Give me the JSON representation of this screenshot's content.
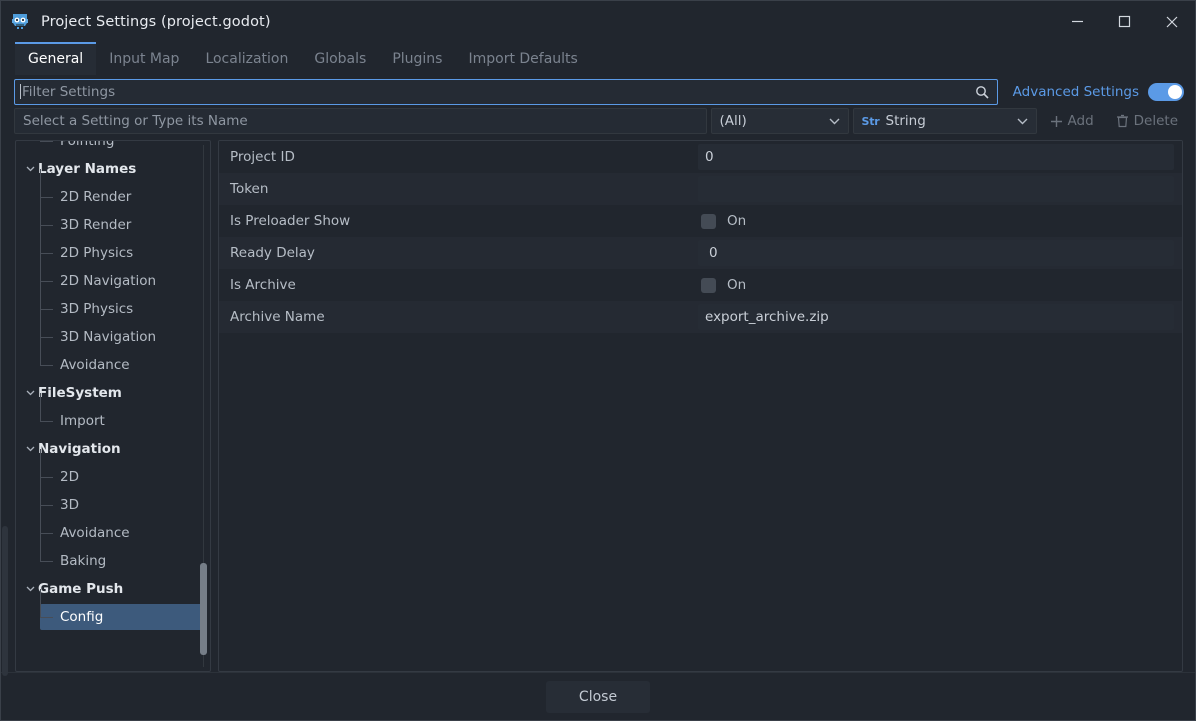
{
  "window": {
    "title": "Project Settings (project.godot)",
    "app_icon": "godot-robot-icon",
    "controls": {
      "minimize": "minimize-icon",
      "maximize": "maximize-icon",
      "close": "close-icon"
    }
  },
  "tabs": [
    {
      "label": "General",
      "active": true
    },
    {
      "label": "Input Map",
      "active": false
    },
    {
      "label": "Localization",
      "active": false
    },
    {
      "label": "Globals",
      "active": false
    },
    {
      "label": "Plugins",
      "active": false
    },
    {
      "label": "Import Defaults",
      "active": false
    }
  ],
  "filter": {
    "placeholder": "Filter Settings",
    "value": "",
    "search_icon": "search-icon",
    "advanced_label": "Advanced Settings",
    "advanced_enabled": true,
    "accent_color": "#5b9ae6"
  },
  "add_setting": {
    "name_placeholder": "Select a Setting or Type its Name",
    "name_value": "",
    "category_value": "(All)",
    "type_value": "String",
    "type_badge": "Str",
    "add_label": "Add",
    "delete_label": "Delete",
    "add_icon": "plus-icon",
    "delete_icon": "trash-icon"
  },
  "tree": [
    {
      "label": "Pointing",
      "type": "leaf",
      "clipped": true
    },
    {
      "label": "Layer Names",
      "type": "category"
    },
    {
      "label": "2D Render",
      "type": "leaf"
    },
    {
      "label": "3D Render",
      "type": "leaf"
    },
    {
      "label": "2D Physics",
      "type": "leaf"
    },
    {
      "label": "2D Navigation",
      "type": "leaf"
    },
    {
      "label": "3D Physics",
      "type": "leaf"
    },
    {
      "label": "3D Navigation",
      "type": "leaf"
    },
    {
      "label": "Avoidance",
      "type": "leaf",
      "last": true
    },
    {
      "label": "FileSystem",
      "type": "category"
    },
    {
      "label": "Import",
      "type": "leaf",
      "last": true
    },
    {
      "label": "Navigation",
      "type": "category"
    },
    {
      "label": "2D",
      "type": "leaf"
    },
    {
      "label": "3D",
      "type": "leaf"
    },
    {
      "label": "Avoidance",
      "type": "leaf"
    },
    {
      "label": "Baking",
      "type": "leaf",
      "last": true
    },
    {
      "label": "Game Push",
      "type": "category"
    },
    {
      "label": "Config",
      "type": "leaf",
      "last": true,
      "selected": true
    }
  ],
  "settings": [
    {
      "name": "Project ID",
      "kind": "text",
      "value": "0"
    },
    {
      "name": "Token",
      "kind": "text",
      "value": ""
    },
    {
      "name": "Is Preloader Show",
      "kind": "check",
      "checked": false,
      "value": "On"
    },
    {
      "name": "Ready Delay",
      "kind": "number",
      "value": "0"
    },
    {
      "name": "Is Archive",
      "kind": "check",
      "checked": false,
      "value": "On"
    },
    {
      "name": "Archive Name",
      "kind": "text",
      "value": "export_archive.zip"
    }
  ],
  "footer": {
    "close_label": "Close"
  }
}
